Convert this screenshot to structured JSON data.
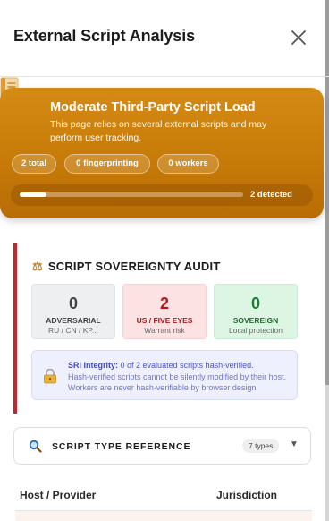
{
  "header": {
    "title": "External Script Analysis"
  },
  "banner": {
    "title": "Moderate Third-Party Script Load",
    "description": "This page relies on several external scripts and may perform user tracking.",
    "pills": [
      "2 total",
      "0 fingerprinting",
      "0 workers"
    ],
    "progress_fraction": 0.12,
    "progress_label": "2 detected",
    "color": "#c97d0a"
  },
  "audit": {
    "title": "SCRIPT SOVEREIGNTY AUDIT",
    "accent_color": "#c0292c",
    "cards": [
      {
        "value": "0",
        "label": "ADVERSARIAL",
        "sub": "RU / CN / KP..."
      },
      {
        "value": "2",
        "label": "US / FIVE EYES",
        "sub": "Warrant risk"
      },
      {
        "value": "0",
        "label": "SOVEREIGN",
        "sub": "Local protection"
      }
    ],
    "sri": {
      "label": "SRI Integrity:",
      "summary": "0 of 2 evaluated scripts hash-verified.",
      "detail": "Hash-verified scripts cannot be silently modified by their host. Workers are never hash-verifiable by browser design."
    }
  },
  "reference": {
    "title": "SCRIPT TYPE REFERENCE",
    "badge": "7 types"
  },
  "table": {
    "columns": [
      "Host / Provider",
      "Jurisdiction"
    ]
  }
}
